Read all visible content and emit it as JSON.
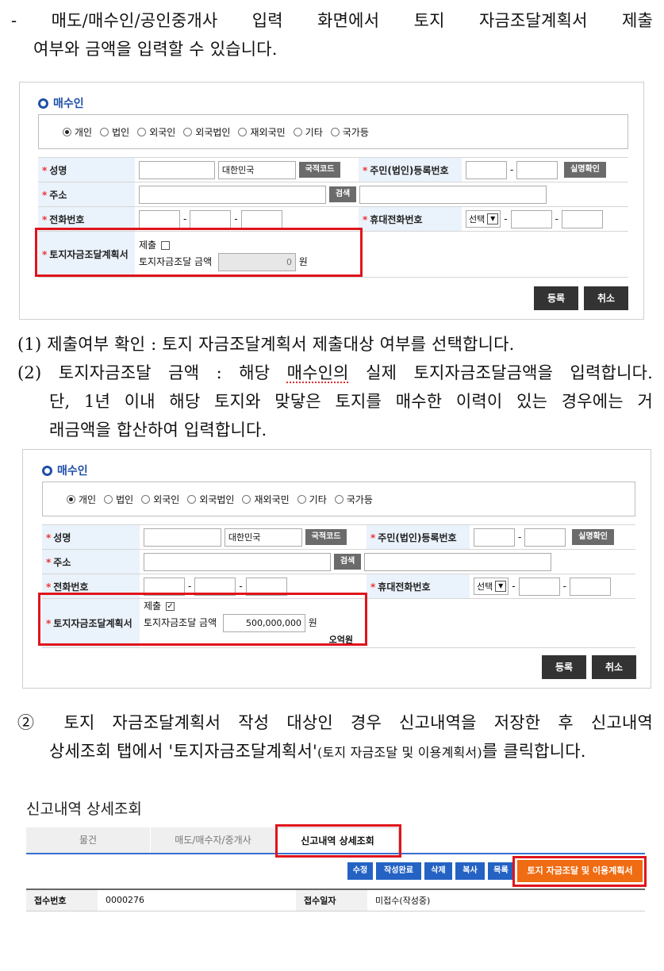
{
  "intro": {
    "line1": "- 매도/매수인/공인중개사 입력 화면에서 토지 자금조달계획서 제출",
    "line2": "여부와 금액을 입력할 수 있습니다."
  },
  "form1": {
    "section_title": "매수인",
    "radios": [
      {
        "label": "개인",
        "checked": true
      },
      {
        "label": "법인",
        "checked": false
      },
      {
        "label": "외국인",
        "checked": false
      },
      {
        "label": "외국법인",
        "checked": false
      },
      {
        "label": "재외국민",
        "checked": false
      },
      {
        "label": "기타",
        "checked": false
      },
      {
        "label": "국가등",
        "checked": false
      }
    ],
    "name_label": "성명",
    "country_value": "대한민국",
    "country_code_btn": "국적코드",
    "rrn_label": "주민(법인)등록번호",
    "verify_btn": "실명확인",
    "address_label": "주소",
    "search_btn": "검색",
    "phone_label": "전화번호",
    "mobile_label": "휴대전화번호",
    "select_value": "선택",
    "plan_label": "토지자금조달계획서",
    "submit_label": "제출",
    "submit_checked": false,
    "amount_label": "토지자금조달 금액",
    "amount_value": "0",
    "won": "원",
    "register_btn": "등록",
    "cancel_btn": "취소"
  },
  "notes": {
    "n1": "(1) 제출여부 확인 : 토지 자금조달계획서 제출대상 여부를 선택합니다.",
    "n2_pre": "(2) 토지자금조달 금액 : 해당 ",
    "n2_under": "매수인의",
    "n2_post": " 실제 토지자금조달금액을 입력합니다.",
    "n2_line2": "단, 1년 이내 해당 토지와 맞닿은 토지를 매수한 이력이 있는 경우에는 거",
    "n2_line3": "래금액을 합산하여 입력합니다."
  },
  "form2": {
    "section_title": "매수인",
    "submit_checked": true,
    "amount_value": "500,000,000",
    "amount_korean": "오억원"
  },
  "step2": {
    "line1": "② 토지 자금조달계획서 작성 대상인 경우 신고내역을 저장한 후 신고내역",
    "line2_a": "상세조회 탭에서 '토지자금조달계획서'",
    "line2_b": "(토지 자금조달 및 이용계획서)",
    "line2_c": "를 클릭합니다."
  },
  "detail": {
    "title": "신고내역 상세조회",
    "tabs": [
      "물건",
      "매도/매수자/중개사",
      "신고내역 상세조회"
    ],
    "buttons": [
      "수정",
      "작성완료",
      "삭제",
      "복사",
      "목록"
    ],
    "plan_button": "토지 자금조달 및 이용계획서",
    "receipt_no_label": "접수번호",
    "receipt_no_value": "0000276",
    "receipt_date_label": "접수일자",
    "receipt_date_value": "미접수(작성중)"
  },
  "colors": {
    "accent_blue": "#1e4fa8",
    "highlight_red": "#e0141c",
    "tab_blue": "#2463c4",
    "orange": "#f06c12"
  }
}
